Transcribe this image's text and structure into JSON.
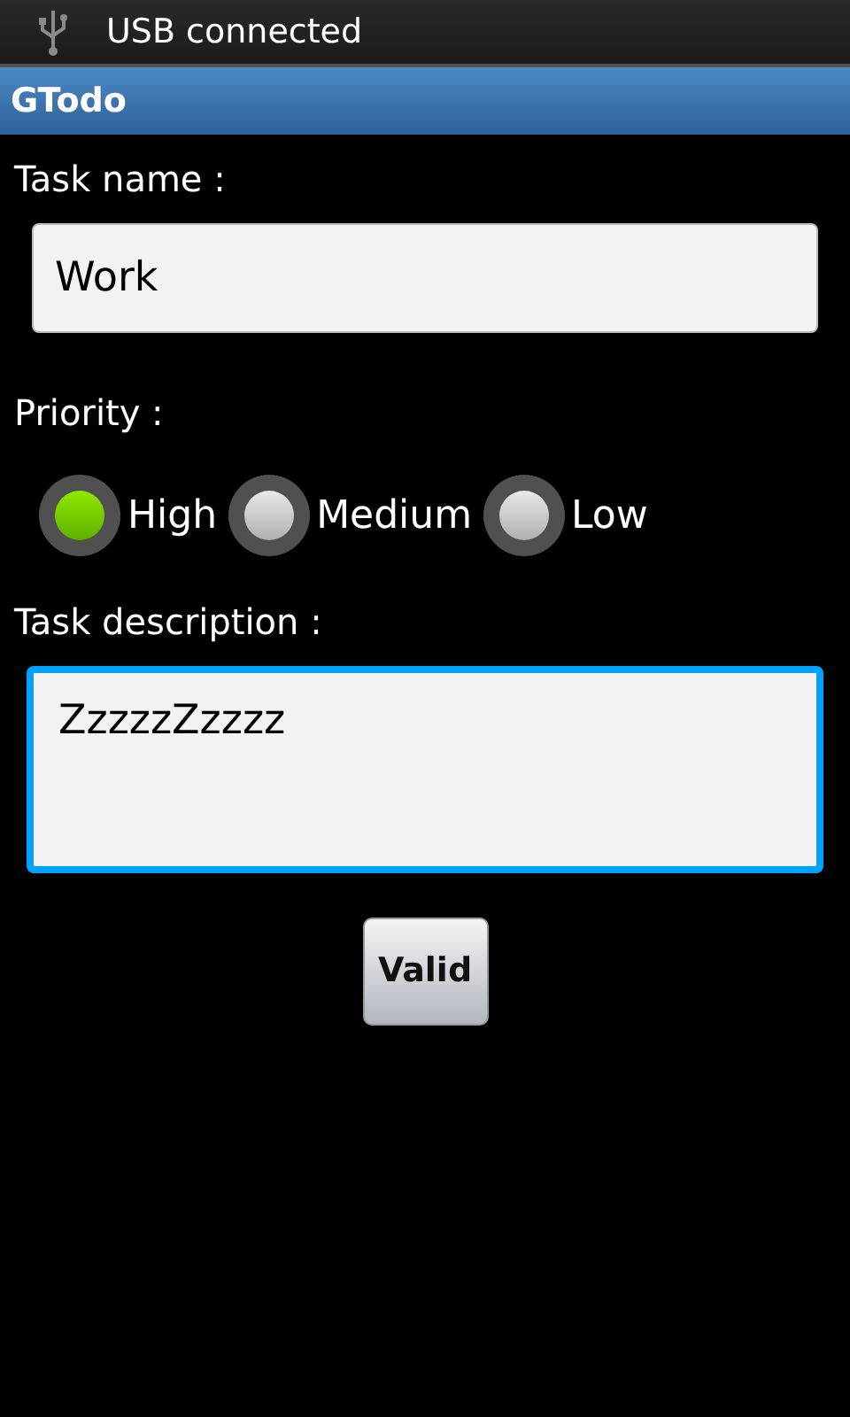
{
  "status_bar": {
    "notification": "USB connected"
  },
  "title_bar": {
    "title": "GTodo"
  },
  "task_name": {
    "label": "Task name :",
    "value": "Work"
  },
  "priority": {
    "label": "Priority :",
    "options": [
      {
        "label": "High",
        "selected": true
      },
      {
        "label": "Medium",
        "selected": false
      },
      {
        "label": "Low",
        "selected": false
      }
    ]
  },
  "task_description": {
    "label": "Task description :",
    "value": "ZzzzzZzzzz",
    "focused": true
  },
  "buttons": [
    "Valid"
  ]
}
